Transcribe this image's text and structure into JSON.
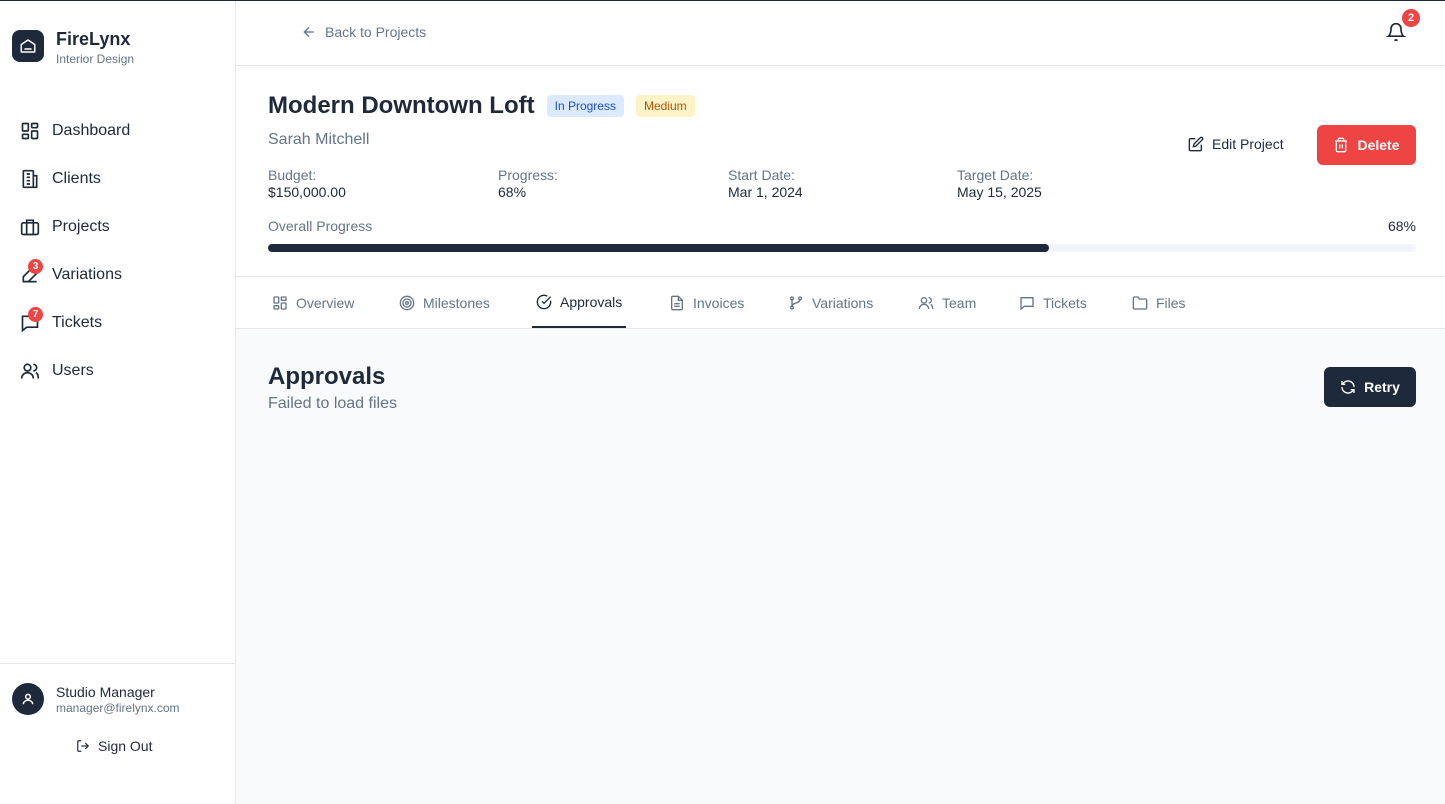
{
  "brand": {
    "name": "FireLynx",
    "subtitle": "Interior Design"
  },
  "nav": [
    {
      "label": "Dashboard",
      "icon": "dashboard-icon"
    },
    {
      "label": "Clients",
      "icon": "building-icon"
    },
    {
      "label": "Projects",
      "icon": "briefcase-icon"
    },
    {
      "label": "Variations",
      "icon": "variations-icon",
      "badge": "3"
    },
    {
      "label": "Tickets",
      "icon": "message-icon",
      "badge": "7"
    },
    {
      "label": "Users",
      "icon": "users-icon"
    }
  ],
  "user": {
    "name": "Studio Manager",
    "email": "manager@firelynx.com",
    "signout_label": "Sign Out"
  },
  "topbar": {
    "back_label": "Back to Projects",
    "notification_count": "2"
  },
  "project": {
    "title": "Modern Downtown Loft",
    "status": "In Progress",
    "priority": "Medium",
    "client": "Sarah Mitchell",
    "edit_label": "Edit Project",
    "delete_label": "Delete",
    "stats": [
      {
        "label": "Budget:",
        "value": "$150,000.00"
      },
      {
        "label": "Progress:",
        "value": "68%"
      },
      {
        "label": "Start Date:",
        "value": "Mar 1, 2024"
      },
      {
        "label": "Target Date:",
        "value": "May 15, 2025"
      }
    ],
    "overall_progress_label": "Overall Progress",
    "overall_progress_text": "68%",
    "overall_progress_fraction": 0.68
  },
  "tabs": [
    {
      "label": "Overview",
      "icon": "overview-icon"
    },
    {
      "label": "Milestones",
      "icon": "target-icon"
    },
    {
      "label": "Approvals",
      "icon": "check-circle-icon",
      "active": true
    },
    {
      "label": "Invoices",
      "icon": "document-icon"
    },
    {
      "label": "Variations",
      "icon": "branch-icon"
    },
    {
      "label": "Team",
      "icon": "team-icon"
    },
    {
      "label": "Tickets",
      "icon": "chat-icon"
    },
    {
      "label": "Files",
      "icon": "folder-icon"
    }
  ],
  "section": {
    "title": "Approvals",
    "error": "Failed to load files",
    "retry_label": "Retry"
  },
  "colors": {
    "primary": "#1e293b",
    "danger": "#ef4444",
    "muted": "#64748b",
    "status_bg": "#dbeafe",
    "priority_bg": "#fef3c7"
  }
}
